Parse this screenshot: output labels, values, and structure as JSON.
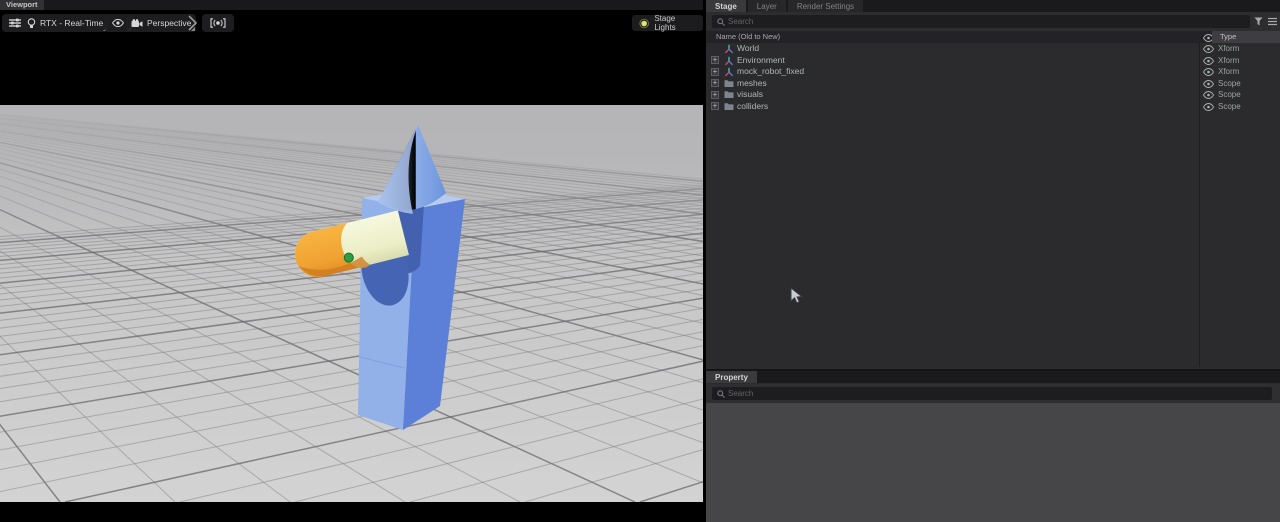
{
  "viewport": {
    "tab_label": "Viewport",
    "toolbar": {
      "renderer_label": "RTX - Real-Time",
      "camera_label": "Perspective",
      "stage_lights_label": "Stage Lights"
    }
  },
  "stage_panel": {
    "tabs": [
      {
        "label": "Stage",
        "active": true
      },
      {
        "label": "Layer",
        "active": false
      },
      {
        "label": "Render Settings",
        "active": false
      }
    ],
    "search_placeholder": "Search",
    "tree": {
      "name_header": "Name (Old to New)",
      "type_header": "Type",
      "rows": [
        {
          "name": "World",
          "type": "Xform",
          "icon": "xform",
          "expandable": false
        },
        {
          "name": "Environment",
          "type": "Xform",
          "icon": "xform",
          "expandable": true
        },
        {
          "name": "mock_robot_fixed",
          "type": "Xform",
          "icon": "xform",
          "expandable": true
        },
        {
          "name": "meshes",
          "type": "Scope",
          "icon": "folder",
          "expandable": true
        },
        {
          "name": "visuals",
          "type": "Scope",
          "icon": "folder",
          "expandable": true
        },
        {
          "name": "colliders",
          "type": "Scope",
          "icon": "folder",
          "expandable": true
        }
      ]
    }
  },
  "property_panel": {
    "tab_label": "Property",
    "search_placeholder": "Search"
  },
  "icons": {
    "expand_glyph": "+"
  },
  "colors": {
    "panel_bg": "#2b2b2e",
    "tab_active_bg": "#3a3a3d",
    "viewport_letterbox": "#000000",
    "ground_gray": "#c6c6c7",
    "model_blue_front": "#92b0e8",
    "model_blue_side": "#5a7ed6",
    "model_blue_slot": "#4361ae",
    "model_cream": "#f0f2d2",
    "model_orange": "#f4a93a",
    "marker_green": "#2f9e3f"
  }
}
